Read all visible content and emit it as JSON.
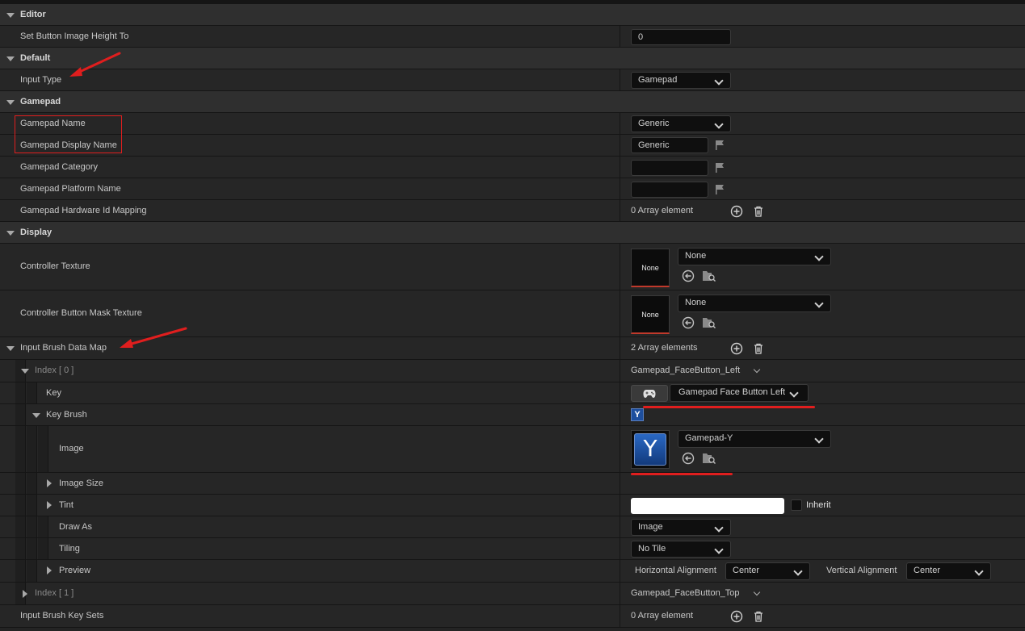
{
  "categories": {
    "editor": "Editor",
    "default": "Default",
    "gamepad": "Gamepad",
    "display": "Display"
  },
  "props": {
    "set_button_image_height": {
      "label": "Set Button Image Height To",
      "value": "0"
    },
    "input_type": {
      "label": "Input Type",
      "value": "Gamepad"
    },
    "gamepad_name": {
      "label": "Gamepad Name",
      "value": "Generic"
    },
    "gamepad_display_name": {
      "label": "Gamepad Display Name",
      "value": "Generic"
    },
    "gamepad_category": {
      "label": "Gamepad Category",
      "value": ""
    },
    "gamepad_platform_name": {
      "label": "Gamepad Platform Name",
      "value": ""
    },
    "gamepad_hw_id_mapping": {
      "label": "Gamepad Hardware Id Mapping",
      "value": "0 Array element"
    },
    "controller_texture": {
      "label": "Controller Texture",
      "thumb": "None",
      "value": "None"
    },
    "controller_button_mask": {
      "label": "Controller Button Mask Texture",
      "thumb": "None",
      "value": "None"
    },
    "input_brush_data_map": {
      "label": "Input Brush Data Map",
      "value": "2 Array elements"
    },
    "index0": {
      "label": "Index [ 0 ]",
      "value": "Gamepad_FaceButton_Left"
    },
    "key": {
      "label": "Key",
      "value": "Gamepad Face Button Left"
    },
    "key_brush": {
      "label": "Key Brush",
      "badge": "Y"
    },
    "image": {
      "label": "Image",
      "glyph": "Y",
      "value": "Gamepad-Y"
    },
    "image_size": {
      "label": "Image Size"
    },
    "tint": {
      "label": "Tint",
      "inherit": "Inherit",
      "color": "#ffffff"
    },
    "draw_as": {
      "label": "Draw As",
      "value": "Image"
    },
    "tiling": {
      "label": "Tiling",
      "value": "No Tile"
    },
    "preview": {
      "label": "Preview",
      "h_label": "Horizontal Alignment",
      "h_value": "Center",
      "v_label": "Vertical Alignment",
      "v_value": "Center"
    },
    "index1": {
      "label": "Index [ 1 ]",
      "value": "Gamepad_FaceButton_Top"
    },
    "input_brush_key_sets": {
      "label": "Input Brush Key Sets",
      "value": "0 Array element"
    }
  },
  "colors": {
    "annotation": "#e01e1e",
    "accent_blue": "#1e4f9e",
    "bg": "#242424"
  }
}
